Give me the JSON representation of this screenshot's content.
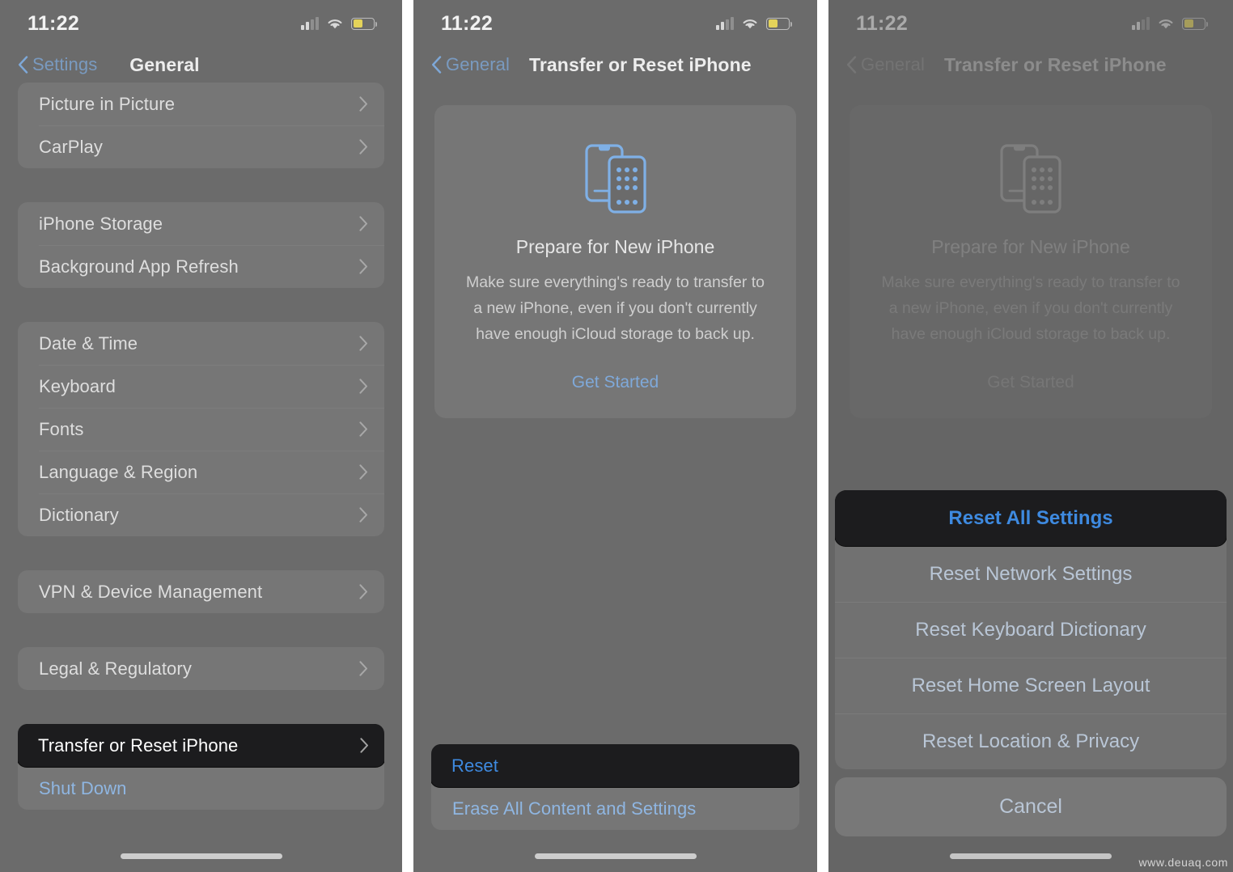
{
  "status_bar": {
    "time": "11:22",
    "icons": [
      "cellular-signal-icon",
      "wifi-icon",
      "battery-icon"
    ],
    "battery_color": "#e4d35a"
  },
  "colors": {
    "screen_bg": "#6b6b6b",
    "group_bg": "rgba(255,255,255,0.075)",
    "highlight_bg": "#1c1c1e",
    "accent_blue": "#3e8ae0",
    "link_blue": "#7fa9da"
  },
  "panel1": {
    "nav": {
      "back_label": "Settings",
      "title": "General"
    },
    "groups": [
      {
        "rows": [
          {
            "label": "Picture in Picture",
            "chevron": true
          },
          {
            "label": "CarPlay",
            "chevron": true
          }
        ]
      },
      {
        "rows": [
          {
            "label": "iPhone Storage",
            "chevron": true
          },
          {
            "label": "Background App Refresh",
            "chevron": true
          }
        ]
      },
      {
        "rows": [
          {
            "label": "Date & Time",
            "chevron": true
          },
          {
            "label": "Keyboard",
            "chevron": true
          },
          {
            "label": "Fonts",
            "chevron": true
          },
          {
            "label": "Language & Region",
            "chevron": true
          },
          {
            "label": "Dictionary",
            "chevron": true
          }
        ]
      },
      {
        "rows": [
          {
            "label": "VPN & Device Management",
            "chevron": true
          }
        ]
      },
      {
        "rows": [
          {
            "label": "Legal & Regulatory",
            "chevron": true
          }
        ]
      },
      {
        "rows": [
          {
            "label": "Transfer or Reset iPhone",
            "chevron": true,
            "highlight": true
          },
          {
            "label": "Shut Down",
            "chevron": false,
            "blue": true
          }
        ]
      }
    ]
  },
  "panel2": {
    "nav": {
      "back_label": "General",
      "title": "Transfer or Reset iPhone"
    },
    "prepare_card": {
      "icon": "two-iphones-icon",
      "title": "Prepare for New iPhone",
      "description": "Make sure everything's ready to transfer to a new iPhone, even if you don't currently have enough iCloud storage to back up.",
      "cta": "Get Started"
    },
    "bottom_rows": [
      {
        "label": "Reset",
        "highlight": true
      },
      {
        "label": "Erase All Content and Settings",
        "highlight": false
      }
    ]
  },
  "panel3": {
    "nav": {
      "back_label": "General",
      "title": "Transfer or Reset iPhone"
    },
    "prepare_card": {
      "icon": "two-iphones-icon",
      "title": "Prepare for New iPhone",
      "description": "Make sure everything's ready to transfer to a new iPhone, even if you don't currently have enough iCloud storage to back up.",
      "cta": "Get Started"
    },
    "action_sheet": {
      "items": [
        {
          "label": "Reset All Settings",
          "highlight": true
        },
        {
          "label": "Reset Network Settings",
          "highlight": false
        },
        {
          "label": "Reset Keyboard Dictionary",
          "highlight": false
        },
        {
          "label": "Reset Home Screen Layout",
          "highlight": false
        },
        {
          "label": "Reset Location & Privacy",
          "highlight": false
        }
      ],
      "cancel": "Cancel"
    }
  },
  "watermark": "www.deuaq.com"
}
